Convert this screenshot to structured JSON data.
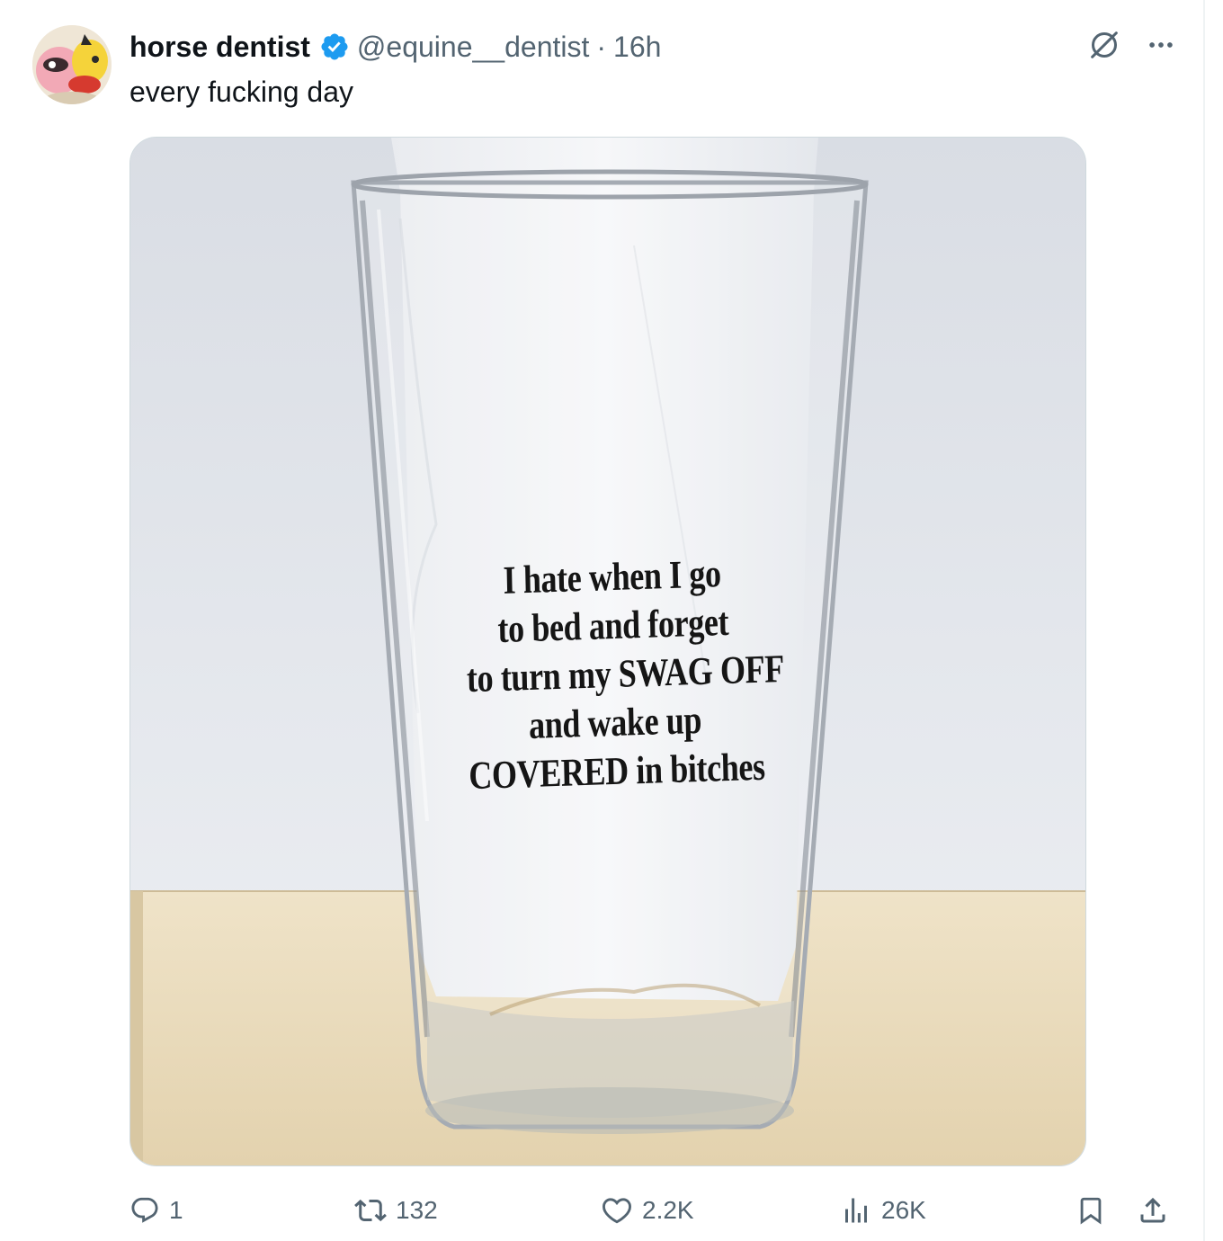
{
  "tweet": {
    "display_name": "horse dentist",
    "handle": "@equine__dentist",
    "separator": "·",
    "time": "16h",
    "text": "every fucking day",
    "verified": true,
    "accent_color": "#1d9bf0"
  },
  "media": {
    "glass_print_lines": [
      "I hate when I go",
      "to bed and forget",
      "to turn my SWAG OFF",
      "and wake up",
      "COVERED in bitches"
    ]
  },
  "actions": {
    "reply_count": "1",
    "repost_count": "132",
    "like_count": "2.2K",
    "view_count": "26K",
    "icons": [
      "reply-icon",
      "repost-icon",
      "like-icon",
      "views-icon",
      "bookmark-icon",
      "share-icon"
    ]
  },
  "top_icons": [
    "grok-icon",
    "more-icon"
  ]
}
